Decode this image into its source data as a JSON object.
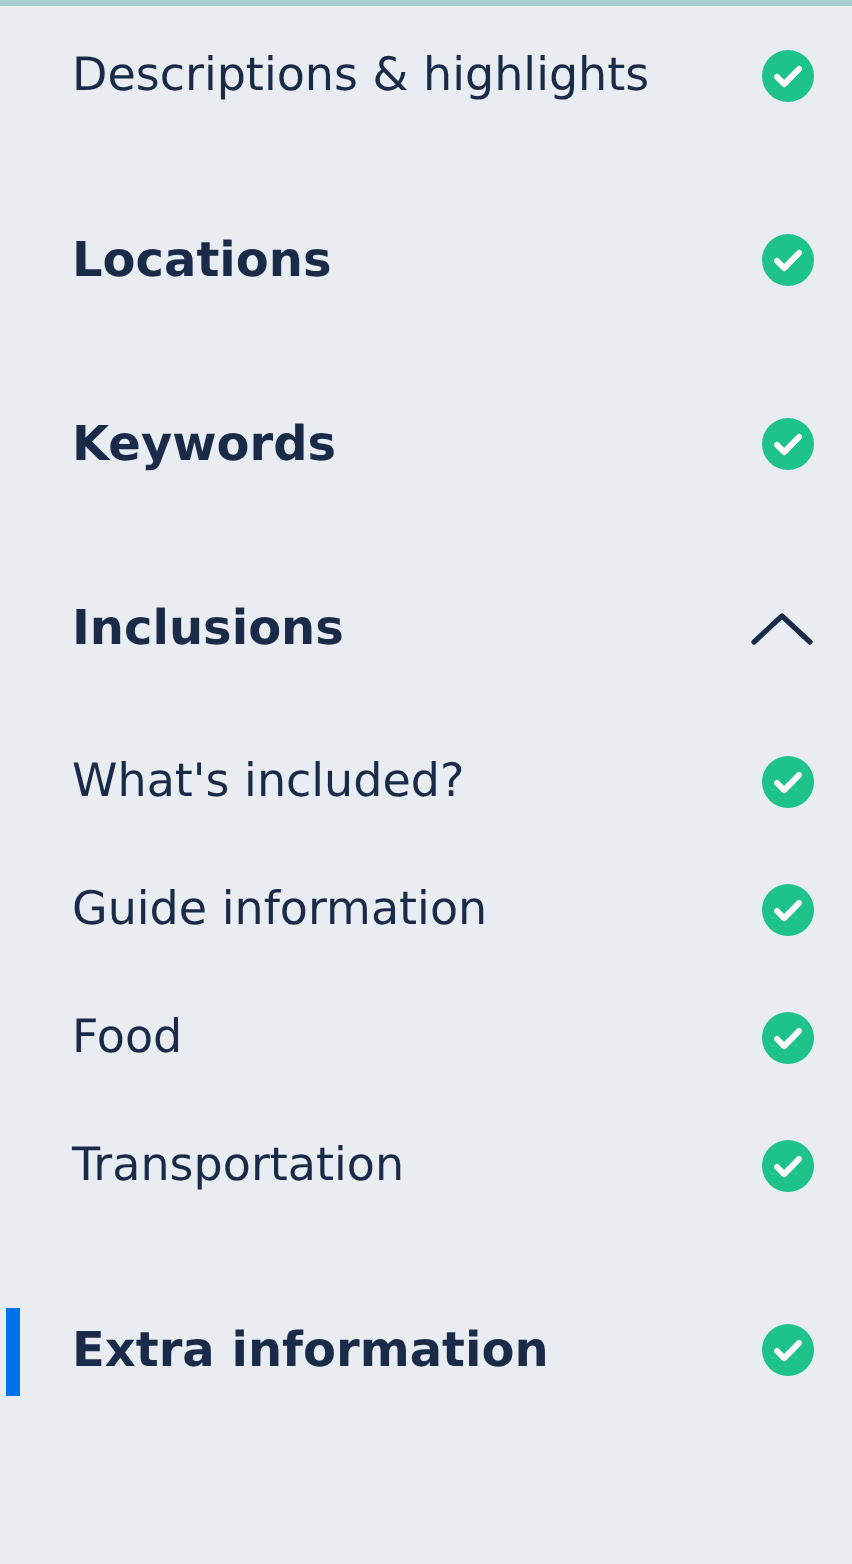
{
  "sections": [
    {
      "label": "Descriptions & highlights",
      "kind": "page",
      "complete": true,
      "selected": false
    },
    {
      "label": "Locations",
      "kind": "section",
      "complete": true,
      "selected": false
    },
    {
      "label": "Keywords",
      "kind": "section",
      "complete": true,
      "selected": false
    },
    {
      "label": "Inclusions",
      "kind": "group",
      "expanded": true,
      "selected": false,
      "children": [
        {
          "label": "What's included?",
          "complete": true
        },
        {
          "label": "Guide information",
          "complete": true
        },
        {
          "label": "Food",
          "complete": true
        },
        {
          "label": "Transportation",
          "complete": true
        }
      ]
    },
    {
      "label": "Extra information",
      "kind": "section",
      "complete": true,
      "selected": true
    }
  ]
}
